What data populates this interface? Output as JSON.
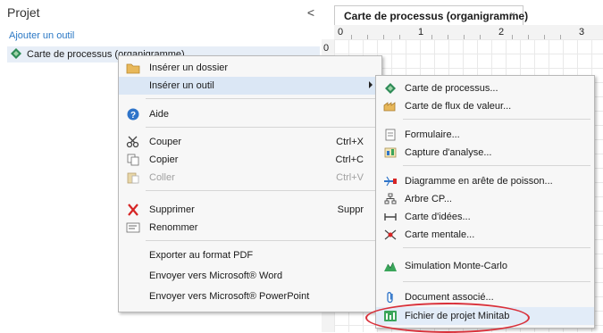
{
  "project_pane": {
    "title": "Projet",
    "collapse_glyph": "<",
    "add_tool_link": "Ajouter un outil",
    "tree_item": "Carte de processus (organigramme)"
  },
  "map": {
    "tab_title": "Carte de processus (organigramme)",
    "tab_close": "×",
    "ruler_top": [
      "0",
      "1",
      "2",
      "3"
    ],
    "ruler_left": [
      "0"
    ]
  },
  "context_menu": {
    "items": [
      {
        "label": "Insérer un dossier",
        "icon": "folder-icon"
      },
      {
        "label": "Insérer un outil",
        "icon": "",
        "has_submenu": true
      },
      {
        "label": "Aide",
        "icon": "help-icon"
      },
      {
        "label": "Couper",
        "shortcut": "Ctrl+X",
        "icon": "cut-icon"
      },
      {
        "label": "Copier",
        "shortcut": "Ctrl+C",
        "icon": "copy-icon"
      },
      {
        "label": "Coller",
        "shortcut": "Ctrl+V",
        "icon": "paste-icon",
        "disabled": true
      },
      {
        "label": "Supprimer",
        "shortcut": "Suppr",
        "icon": "delete-icon"
      },
      {
        "label": "Renommer",
        "icon": "rename-icon"
      },
      {
        "label": "Exporter au format PDF"
      },
      {
        "label": "Envoyer vers Microsoft® Word"
      },
      {
        "label": "Envoyer vers Microsoft® PowerPoint"
      }
    ]
  },
  "submenu": {
    "items": [
      {
        "label": "Carte de processus...",
        "icon": "process-map-icon"
      },
      {
        "label": "Carte de flux de valeur...",
        "icon": "value-stream-icon"
      },
      {
        "label": "Formulaire...",
        "icon": "form-icon"
      },
      {
        "label": "Capture d'analyse...",
        "icon": "analysis-capture-icon"
      },
      {
        "label": "Diagramme en arête de poisson...",
        "icon": "fishbone-icon"
      },
      {
        "label": "Arbre CP...",
        "icon": "ctq-tree-icon"
      },
      {
        "label": "Carte d'idées...",
        "icon": "idea-map-icon"
      },
      {
        "label": "Carte mentale...",
        "icon": "mind-map-icon"
      },
      {
        "label": "Simulation Monte-Carlo",
        "icon": "monte-carlo-icon"
      },
      {
        "label": "Document associé...",
        "icon": "attachment-icon"
      },
      {
        "label": "Fichier de projet Minitab",
        "icon": "minitab-project-icon"
      }
    ]
  },
  "colors": {
    "link": "#2b78c5",
    "menu_highlight": "#dbe7f5",
    "annotation_oval": "#d9303a"
  }
}
